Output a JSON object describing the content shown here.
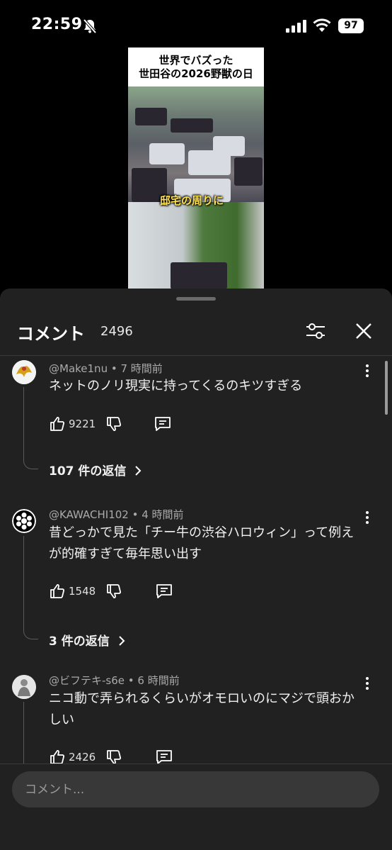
{
  "status": {
    "time": "22:59",
    "battery": "97"
  },
  "video": {
    "title_line1": "世界でバズった",
    "title_line2": "世田谷の2026野獣の日",
    "caption": "邸宅の周りに"
  },
  "comments_panel": {
    "title": "コメント",
    "count": "2496",
    "input_placeholder": "コメント...",
    "items": [
      {
        "author": "@Make1nu",
        "time": "7 時間前",
        "text": "ネットのノリ現実に持ってくるのキツすぎる",
        "likes": "9221",
        "replies": "107 件の返信"
      },
      {
        "author": "@KAWACHI102",
        "time": "4 時間前",
        "text": "昔どっかで見た「チー牛の渋谷ハロウィン」って例えが的確すぎて毎年思い出す",
        "likes": "1548",
        "replies": "3 件の返信"
      },
      {
        "author": "@ビフテキ-s6e",
        "time": "6 時間前",
        "text": "ニコ動で弄られるくらいがオモロいのにマジで頭おかしい",
        "likes": "2426"
      }
    ]
  },
  "icons": {
    "status": [
      "bell-slash-icon",
      "signal-icon",
      "wifi-icon",
      "battery-icon"
    ],
    "panel": [
      "filter-icon",
      "close-icon",
      "more-vert-icon",
      "thumb-up-icon",
      "thumb-down-icon",
      "reply-icon",
      "chevron-right-icon"
    ]
  }
}
